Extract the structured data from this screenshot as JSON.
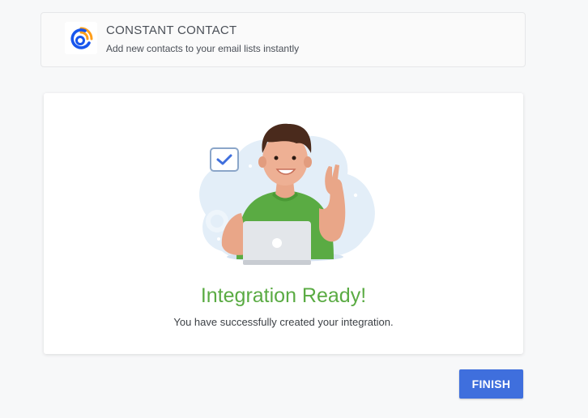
{
  "header": {
    "logo_icon": "constant-contact-logo",
    "title": "CONSTANT CONTACT",
    "description": "Add new contacts to your email lists instantly"
  },
  "main": {
    "illustration": "person-at-laptop-peace-sign",
    "title": "Integration Ready!",
    "description": "You have successfully created your integration."
  },
  "footer": {
    "finish_label": "FINISH"
  },
  "colors": {
    "accent": "#3f6fdd",
    "success": "#5aab43",
    "logo_blue": "#1856ed",
    "logo_orange": "#ff9e1a"
  }
}
